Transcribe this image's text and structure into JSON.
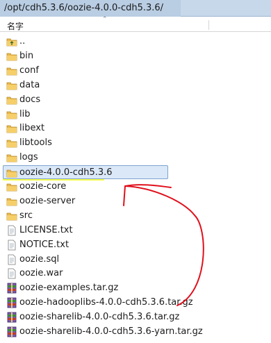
{
  "path_bar": {
    "path": "/opt/cdh5.3.6/oozie-4.0.0-cdh5.3.6/"
  },
  "header": {
    "name_col": "名字"
  },
  "files": [
    {
      "name": "..",
      "type": "folder-up"
    },
    {
      "name": "bin",
      "type": "folder"
    },
    {
      "name": "conf",
      "type": "folder"
    },
    {
      "name": "data",
      "type": "folder"
    },
    {
      "name": "docs",
      "type": "folder"
    },
    {
      "name": "lib",
      "type": "folder"
    },
    {
      "name": "libext",
      "type": "folder"
    },
    {
      "name": "libtools",
      "type": "folder"
    },
    {
      "name": "logs",
      "type": "folder"
    },
    {
      "name": "oozie-4.0.0-cdh5.3.6",
      "type": "folder",
      "selected": true
    },
    {
      "name": "oozie-core",
      "type": "folder"
    },
    {
      "name": "oozie-server",
      "type": "folder"
    },
    {
      "name": "src",
      "type": "folder"
    },
    {
      "name": "LICENSE.txt",
      "type": "text"
    },
    {
      "name": "NOTICE.txt",
      "type": "text"
    },
    {
      "name": "oozie.sql",
      "type": "doc"
    },
    {
      "name": "oozie.war",
      "type": "doc"
    },
    {
      "name": "oozie-examples.tar.gz",
      "type": "archive"
    },
    {
      "name": "oozie-hadooplibs-4.0.0-cdh5.3.6.tar.gz",
      "type": "archive"
    },
    {
      "name": "oozie-sharelib-4.0.0-cdh5.3.6.tar.gz",
      "type": "archive"
    },
    {
      "name": "oozie-sharelib-4.0.0-cdh5.3.6-yarn.tar.gz",
      "type": "archive"
    }
  ],
  "annotation": {
    "color": "#e0101c"
  }
}
